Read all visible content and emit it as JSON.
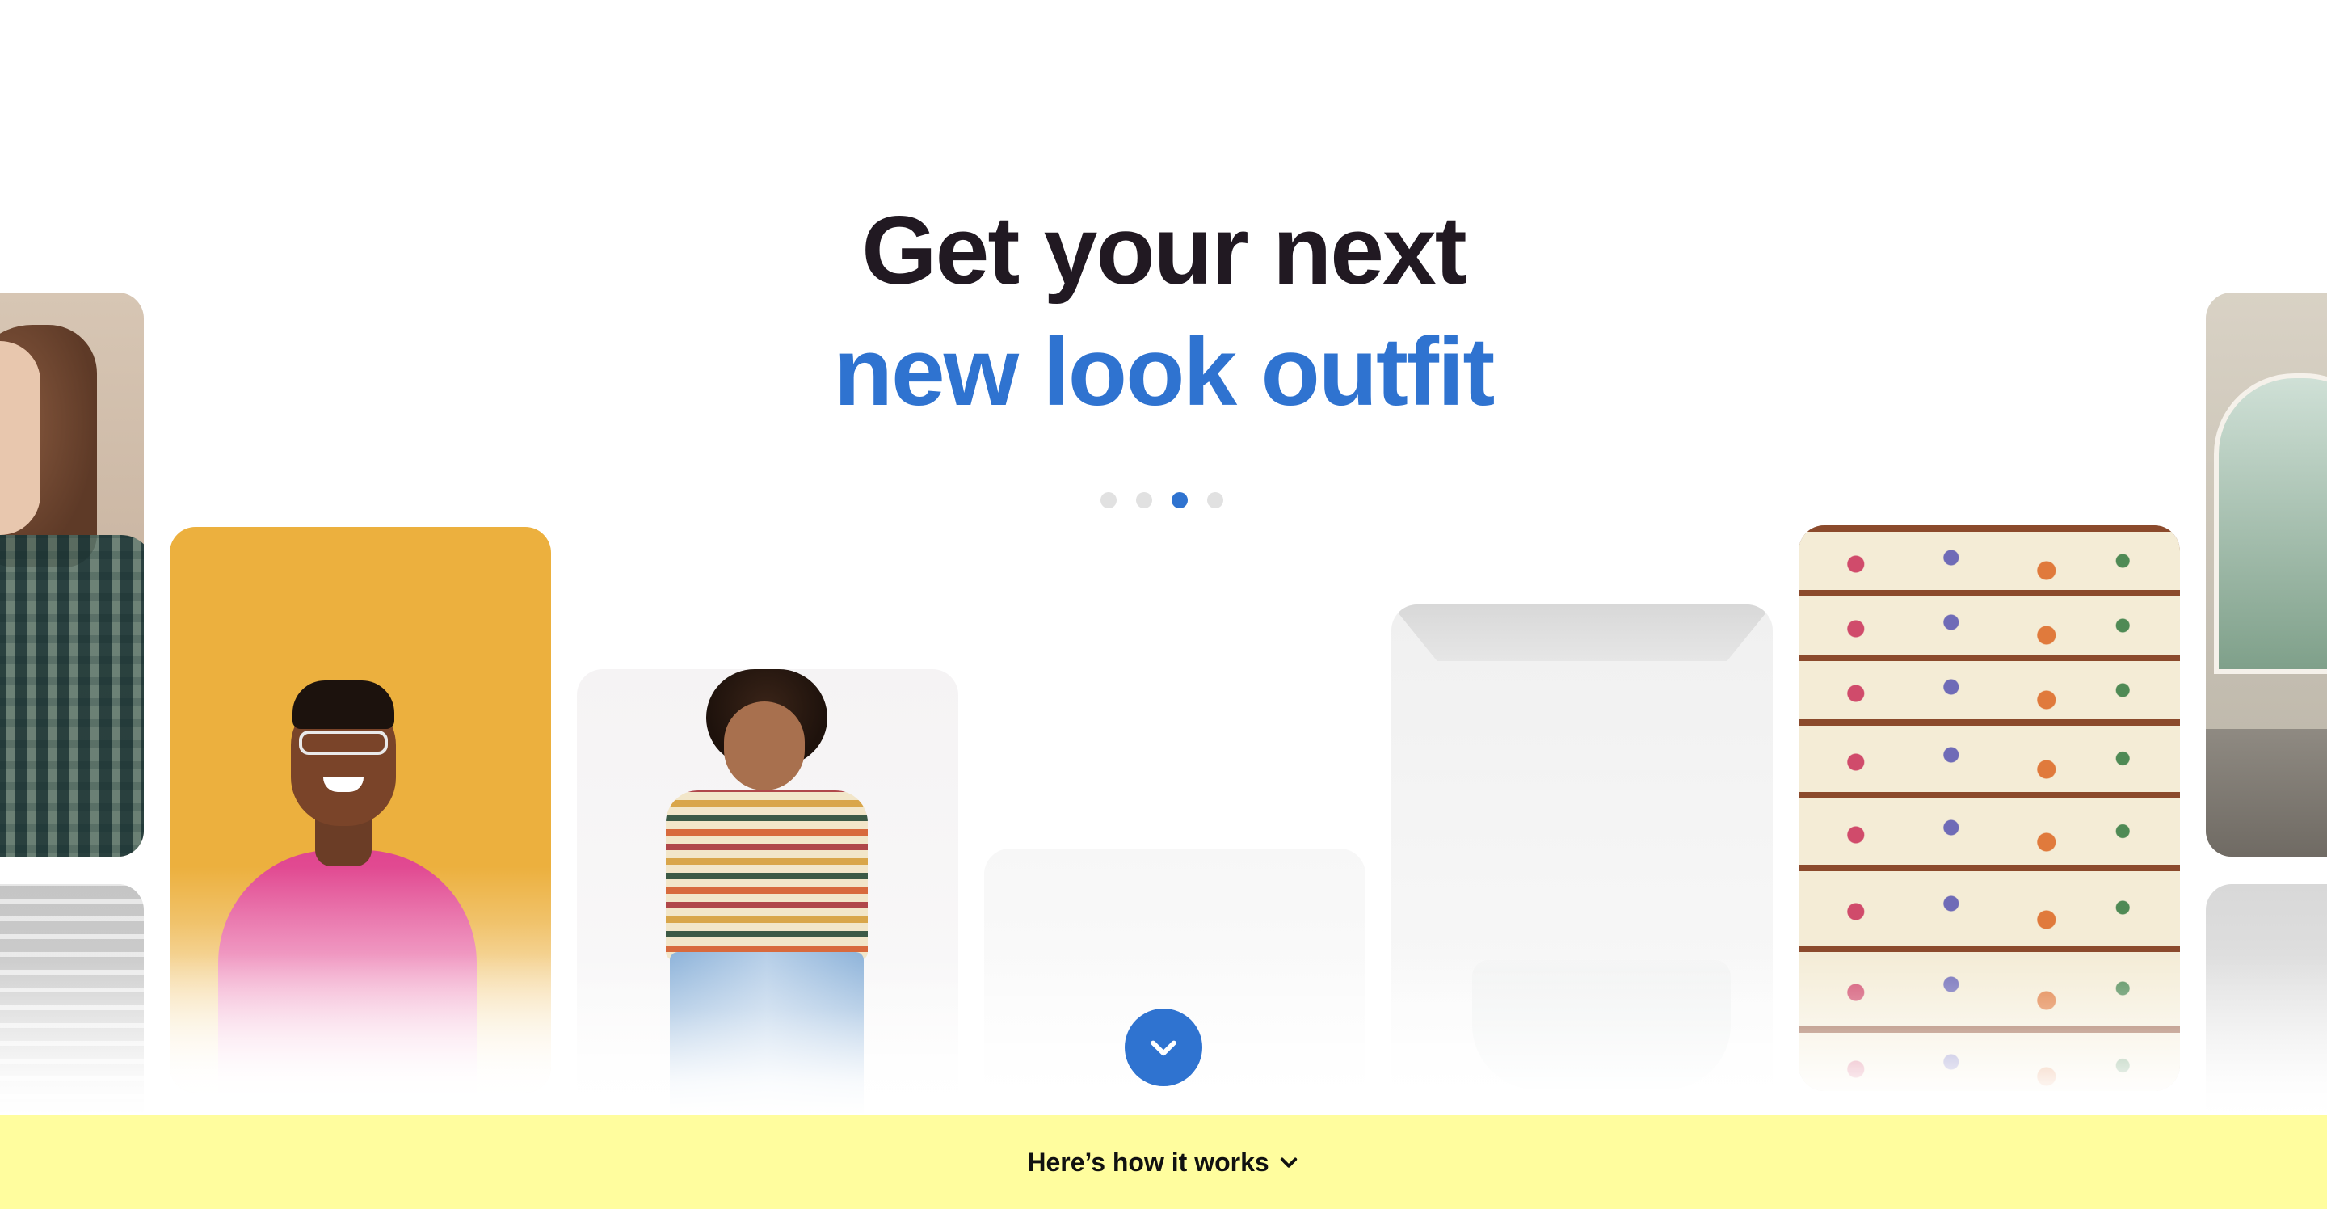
{
  "hero": {
    "line1": "Get your next",
    "line2": "new look outfit",
    "accent_color": "#2f73d0",
    "heading_color": "#211922"
  },
  "carousel": {
    "dot_count": 4,
    "active_dot_index": 2
  },
  "cards": [
    {
      "subject": "woman-plaid-shirt"
    },
    {
      "subject": "blurred-photo"
    },
    {
      "subject": "man-pink-sweater-yellow-background"
    },
    {
      "subject": "woman-striped-tee-jeans"
    },
    {
      "subject": "white-room"
    },
    {
      "subject": "white-bathroom"
    },
    {
      "subject": "floral-staircase"
    },
    {
      "subject": "room-arched-window"
    },
    {
      "subject": "blurred-photo"
    }
  ],
  "scroll": {
    "icon": "chevron-down-icon",
    "color": "#2f73d0"
  },
  "how_it_works": {
    "label": "Here’s how it works",
    "icon": "chevron-down-icon",
    "background": "#fffd9e"
  }
}
